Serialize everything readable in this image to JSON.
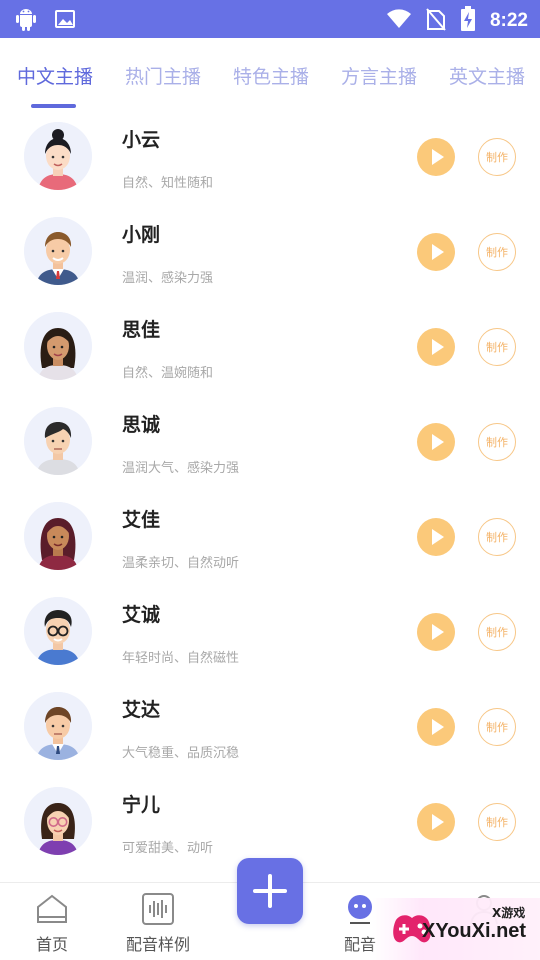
{
  "status_bar": {
    "time": "8:22",
    "icons": [
      "android-icon",
      "image-icon",
      "wifi-icon",
      "no-sim-icon",
      "battery-charging-icon"
    ]
  },
  "tabs": [
    {
      "label": "中文主播",
      "active": true
    },
    {
      "label": "热门主播",
      "active": false
    },
    {
      "label": "特色主播",
      "active": false
    },
    {
      "label": "方言主播",
      "active": false
    },
    {
      "label": "英文主播",
      "active": false
    }
  ],
  "anchors": [
    {
      "name": "小云",
      "desc": "自然、知性随和",
      "make_label": "制作",
      "avatar": "avatar-female-bun-icon"
    },
    {
      "name": "小刚",
      "desc": "温润、感染力强",
      "make_label": "制作",
      "avatar": "avatar-male-suit-icon"
    },
    {
      "name": "思佳",
      "desc": "自然、温婉随和",
      "make_label": "制作",
      "avatar": "avatar-female-longhair-icon"
    },
    {
      "name": "思诚",
      "desc": "温润大气、感染力强",
      "make_label": "制作",
      "avatar": "avatar-male-casual-icon"
    },
    {
      "name": "艾佳",
      "desc": "温柔亲切、自然动听",
      "make_label": "制作",
      "avatar": "avatar-female-dark-icon"
    },
    {
      "name": "艾诚",
      "desc": "年轻时尚、自然磁性",
      "make_label": "制作",
      "avatar": "avatar-male-glasses-icon"
    },
    {
      "name": "艾达",
      "desc": "大气稳重、品质沉稳",
      "make_label": "制作",
      "avatar": "avatar-male-tie-icon"
    },
    {
      "name": "宁儿",
      "desc": "可爱甜美、动听",
      "make_label": "制作",
      "avatar": "avatar-female-glasses-icon"
    }
  ],
  "bottom_nav": [
    {
      "label": "首页",
      "icon": "home-icon"
    },
    {
      "label": "配音样例",
      "icon": "waveform-icon"
    },
    {
      "label": "配音",
      "icon": "robot-icon"
    },
    {
      "label": "",
      "icon": "profile-icon"
    }
  ],
  "fab": {
    "icon": "plus-icon"
  },
  "watermark": {
    "small": "X游戏",
    "text": "XYouXi.net"
  },
  "colors": {
    "primary": "#6771e5",
    "tab_inactive": "#aab0e8",
    "play": "#fbc97a",
    "make_border": "#f7c788",
    "desc": "#a8a8a8"
  }
}
